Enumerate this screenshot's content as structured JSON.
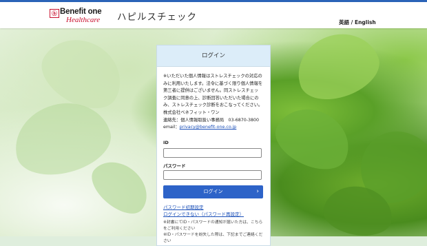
{
  "colors": {
    "accent": "#2d63c8",
    "brand_red": "#c8102e",
    "panel_head": "#dcedf9"
  },
  "header": {
    "logo_mark": "ⓑ",
    "logo_brand": "Benefit one",
    "logo_sub": "Healthcare",
    "title": "ハピルスチェック",
    "lang_ja": "英語",
    "lang_sep": " / ",
    "lang_en": "English"
  },
  "login": {
    "heading": "ログイン",
    "notice_lines": [
      "※いただいた個人情報はストレスチェックの対応の",
      "みに利用いたします。法令に基づく限り個人情報を",
      "第三者に提供はございません。同ストレスチェッ",
      "ク調査に同意の上、診断回答いただいた場合にの",
      "み、ストレスチェック診断をおこなってください。",
      "株式会社ベネフィット・ワン",
      "連絡先：個人情報取扱い事務局　03-6870-3800"
    ],
    "email_label": "email：",
    "email_link": "privacy@benefit-one.co.jp",
    "id_label": "ID",
    "password_label": "パスワード",
    "login_button": "ログイン",
    "login_arrow": "›",
    "initial_password_link": "パスワード初期設定",
    "cannot_login_link": "ログインできない（パスワード再設定）",
    "note1": "※封書にてID・パスワードの通知が届いた方は、こちらをご利用ください",
    "note2": "※ID・パスワードを紛失した際は、下記までご連絡ください"
  }
}
